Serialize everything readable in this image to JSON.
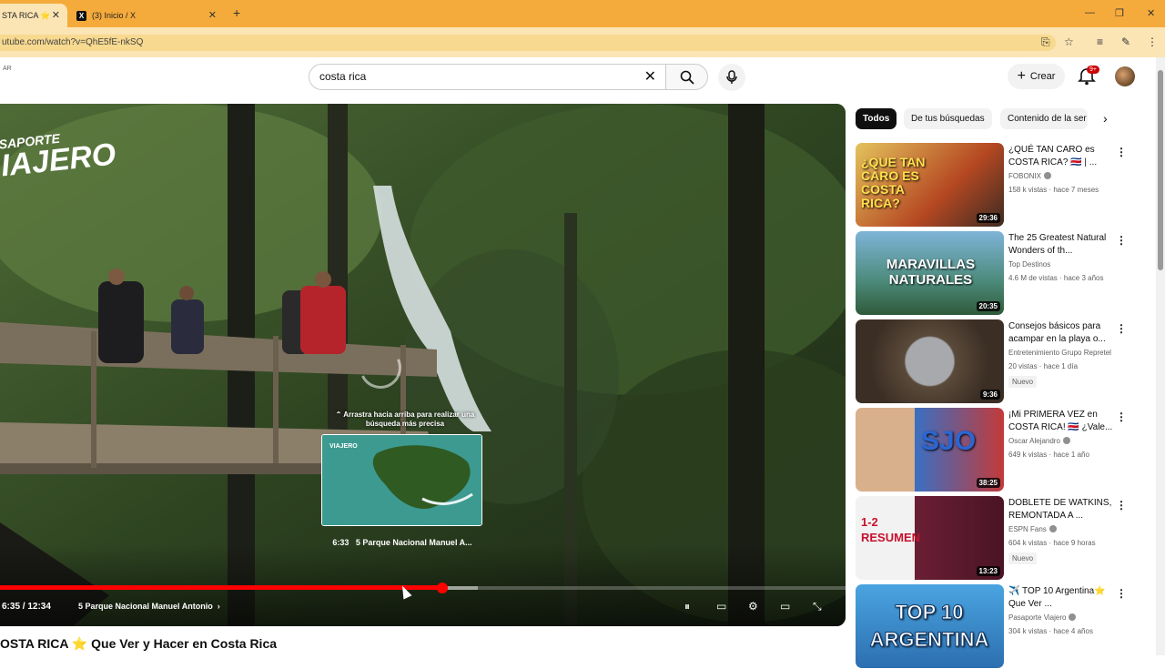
{
  "browser": {
    "tabs": [
      {
        "label": "STA RICA ⭐"
      },
      {
        "label": "(3) Inicio / X"
      }
    ],
    "url": "utube.com/watch?v=QhE5fE-nkSQ"
  },
  "header": {
    "country": "AR",
    "search_value": "costa rica",
    "create_label": "Crear",
    "notifications": "9+"
  },
  "player": {
    "watermark_line1": "SAPORTE",
    "watermark_line2": "IAJERO",
    "hint": "⌃ Arrastra hacia arriba para realizar una búsqueda más precisa",
    "preview_time": "6:33",
    "preview_chapter": "5 Parque Nacional Manuel A...",
    "preview_tag": "VIAJERO",
    "time": "6:35 / 12:34",
    "chapter": "5 Parque Nacional Manuel Antonio",
    "progress": 0.523
  },
  "video_title": {
    "prefix": "OSTA RICA",
    "star": "⭐",
    "rest": " Que Ver y Hacer en Costa Rica"
  },
  "chips": [
    "Todos",
    "De tus búsquedas",
    "Contenido de la ser"
  ],
  "recs": [
    {
      "title": "¿QUÉ TAN CARO es COSTA RICA? 🇨🇷 | ...",
      "channel": "FOBONIX",
      "verified": true,
      "meta": "158 k vistas · hace 7 meses",
      "duration": "29:36",
      "new": "",
      "thumb_text": "¿QUE TAN CARO ES COSTA RICA?"
    },
    {
      "title": "The 25 Greatest Natural Wonders of th...",
      "channel": "Top Destinos",
      "verified": false,
      "meta": "4.6 M de vistas · hace 3 años",
      "duration": "20:35",
      "new": "",
      "thumb_text": "MARAVILLAS NATURALES"
    },
    {
      "title": "Consejos básicos para acampar en la playa o...",
      "channel": "Entretenimiento Grupo Repretel",
      "verified": false,
      "meta": "20 vistas · hace 1 día",
      "duration": "9:36",
      "new": "Nuevo",
      "thumb_text": ""
    },
    {
      "title": "¡Mi PRIMERA VEZ en COSTA RICA! 🇨🇷 ¿Vale...",
      "channel": "Oscar Alejandro",
      "verified": true,
      "meta": "649 k vistas · hace 1 año",
      "duration": "38:25",
      "new": "",
      "thumb_text": "SJO"
    },
    {
      "title": "DOBLETE DE WATKINS, REMONTADA A ...",
      "channel": "ESPN Fans",
      "verified": true,
      "meta": "604 k vistas · hace 9 horas",
      "duration": "13:23",
      "new": "Nuevo",
      "thumb_text": "1-2 RESUMEN"
    },
    {
      "title": "✈️ TOP 10 Argentina⭐ Que Ver ...",
      "channel": "Pasaporte Viajero",
      "verified": true,
      "meta": "304 k vistas · hace 4 años",
      "duration": "",
      "new": "",
      "thumb_text": "TOP 10 ARGENTINA"
    }
  ],
  "colors": {
    "accent": "#ff0000",
    "chrome": "#f5ab3b",
    "chrome_light": "#fbe5b5"
  }
}
